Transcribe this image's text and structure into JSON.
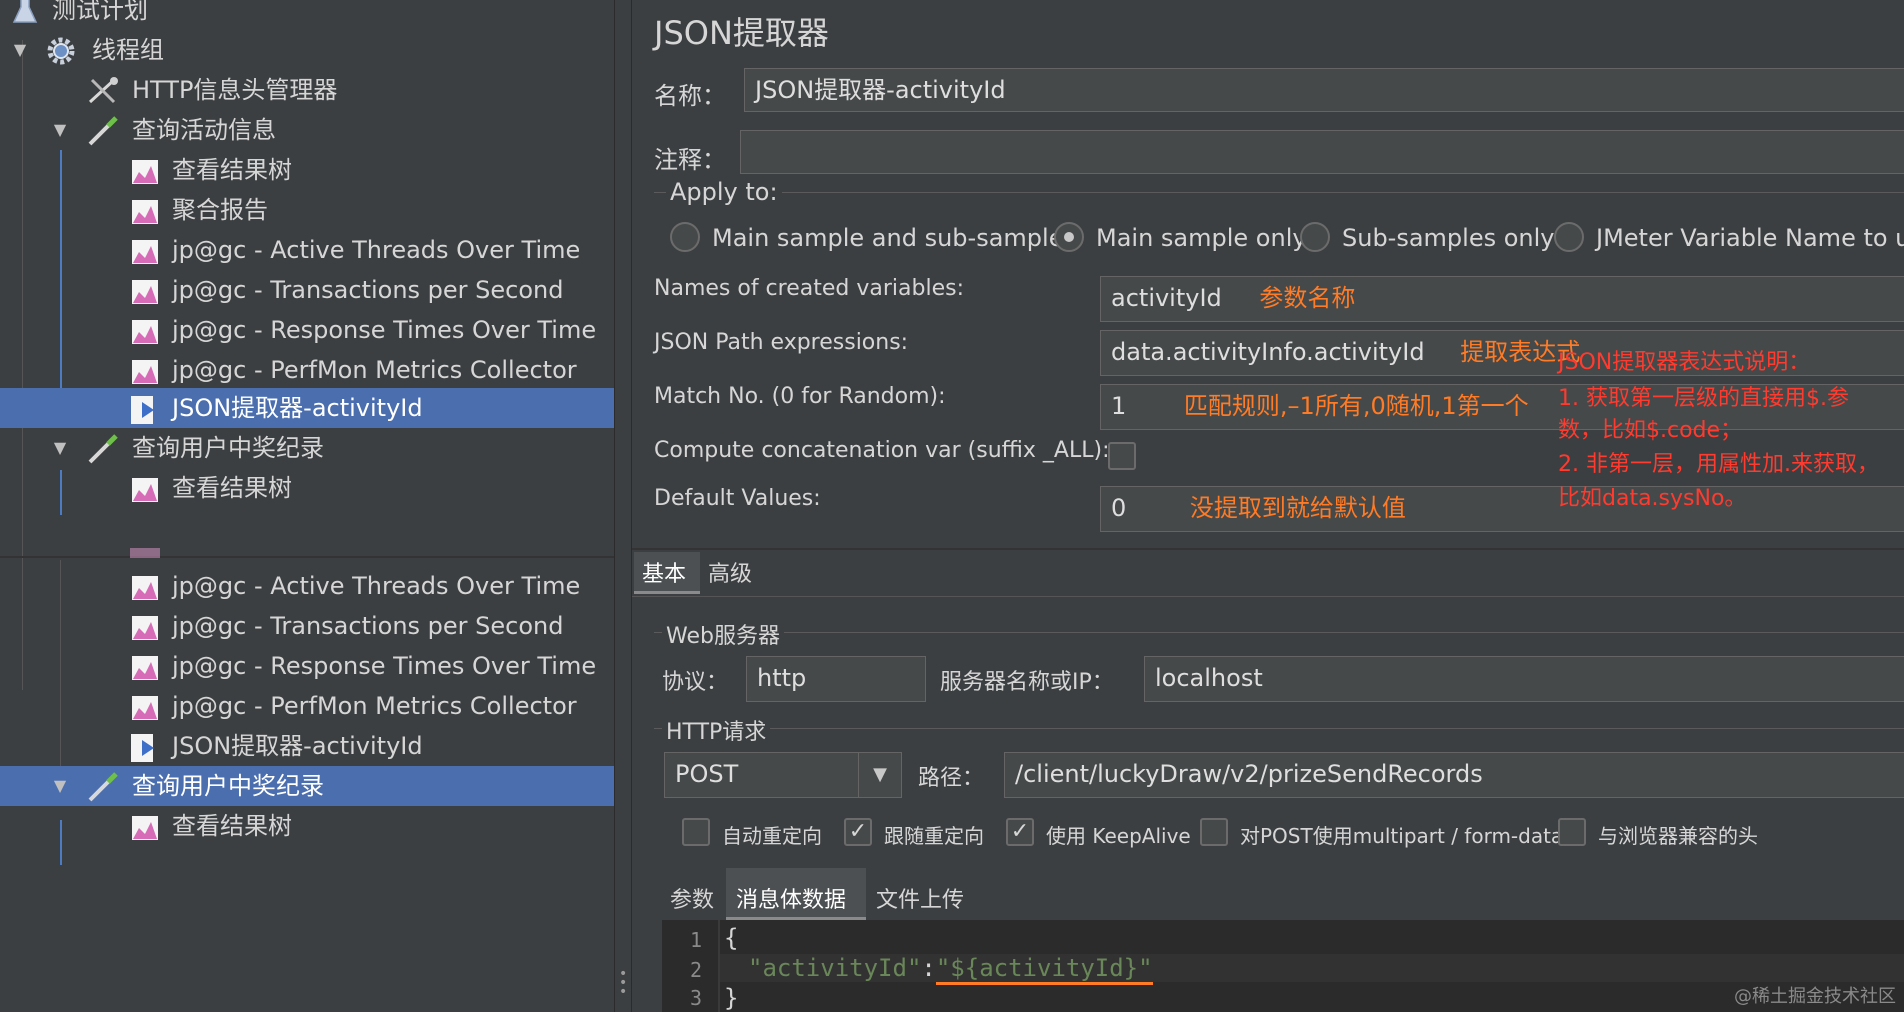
{
  "tree": {
    "items": [
      {
        "label": "测试计划",
        "icon": "flask-icon"
      },
      {
        "label": "线程组",
        "icon": "gear-icon"
      },
      {
        "label": "HTTP信息头管理器",
        "icon": "tools-icon"
      },
      {
        "label": "查询活动信息",
        "icon": "pipette-icon"
      },
      {
        "label": "查看结果树",
        "icon": "graph-icon"
      },
      {
        "label": "聚合报告",
        "icon": "graph-icon"
      },
      {
        "label": "jp@gc - Active Threads Over Time",
        "icon": "graph-icon"
      },
      {
        "label": "jp@gc - Transactions per Second",
        "icon": "graph-icon"
      },
      {
        "label": "jp@gc - Response Times Over Time",
        "icon": "graph-icon"
      },
      {
        "label": "jp@gc - PerfMon Metrics Collector",
        "icon": "graph-icon"
      },
      {
        "label": "JSON提取器-activityId",
        "icon": "extractor-icon"
      },
      {
        "label": "查询用户中奖纪录",
        "icon": "pipette-icon"
      },
      {
        "label": "查看结果树",
        "icon": "graph-icon"
      },
      {
        "label": "jp@gc - Active Threads Over Time",
        "icon": "graph-icon"
      },
      {
        "label": "jp@gc - Transactions per Second",
        "icon": "graph-icon"
      },
      {
        "label": "jp@gc - Response Times Over Time",
        "icon": "graph-icon"
      },
      {
        "label": "jp@gc - PerfMon Metrics Collector",
        "icon": "graph-icon"
      },
      {
        "label": "JSON提取器-activityId",
        "icon": "extractor-icon"
      },
      {
        "label": "查询用户中奖纪录",
        "icon": "pipette-icon"
      },
      {
        "label": "查看结果树",
        "icon": "graph-icon"
      }
    ]
  },
  "extractor": {
    "title": "JSON提取器",
    "name_label": "名称：",
    "name_value": "JSON提取器-activityId",
    "comment_label": "注释：",
    "comment_value": "",
    "apply_to_label": "Apply to:",
    "apply_options": [
      "Main sample and sub-samples",
      "Main sample only",
      "Sub-samples only",
      "JMeter Variable Name to use"
    ],
    "apply_selected": "Main sample only",
    "var_names_label": "Names of created variables:",
    "var_names_value": "activityId",
    "var_names_note": "参数名称",
    "json_path_label": "JSON Path expressions:",
    "json_path_value": "data.activityInfo.activityId",
    "json_path_note": "提取表达式",
    "match_no_label": "Match No. (0 for Random):",
    "match_no_value": "1",
    "match_no_note": "匹配规则,–1所有,0随机,1第一个",
    "concat_label": "Compute concatenation var (suffix _ALL):",
    "default_label": "Default Values:",
    "default_value": "0",
    "default_note": "没提取到就给默认值",
    "explain_title": "JSON提取器表达式说明：",
    "explain_1a": "1. 获取第一层级的直接用$.参",
    "explain_1b": "数，比如$.code；",
    "explain_2a": "2. 非第一层，用属性加.来获取，",
    "explain_2b": "比如data.sysNo。"
  },
  "http": {
    "tabs": [
      "基本",
      "高级"
    ],
    "web_server_label": "Web服务器",
    "protocol_label": "协议：",
    "protocol_value": "http",
    "server_label": "服务器名称或IP：",
    "server_value": "localhost",
    "request_label": "HTTP请求",
    "method_value": "POST",
    "path_label": "路径：",
    "path_value": "/client/luckyDraw/v2/prizeSendRecords",
    "checkboxes": [
      {
        "label": "自动重定向",
        "checked": false
      },
      {
        "label": "跟随重定向",
        "checked": true
      },
      {
        "label": "使用 KeepAlive",
        "checked": true
      },
      {
        "label": "对POST使用multipart / form-data",
        "checked": false
      },
      {
        "label": "与浏览器兼容的头",
        "checked": false
      }
    ],
    "body_tabs": [
      "参数",
      "消息体数据",
      "文件上传"
    ],
    "code_lines": [
      "{",
      "  \"activityId\":\"${activityId}\"",
      "}"
    ],
    "line_numbers": [
      "1",
      "2",
      "3"
    ],
    "code_key": "\"activityId\"",
    "code_colon": ":",
    "code_value": "\"${activityId}\""
  },
  "watermark": "@稀土掘金技术社区",
  "colors": {
    "selection": "#4b6eaf",
    "annotation_orange": "#ff7b26",
    "annotation_red": "#ff3b2f",
    "code_string": "#6a8759"
  }
}
